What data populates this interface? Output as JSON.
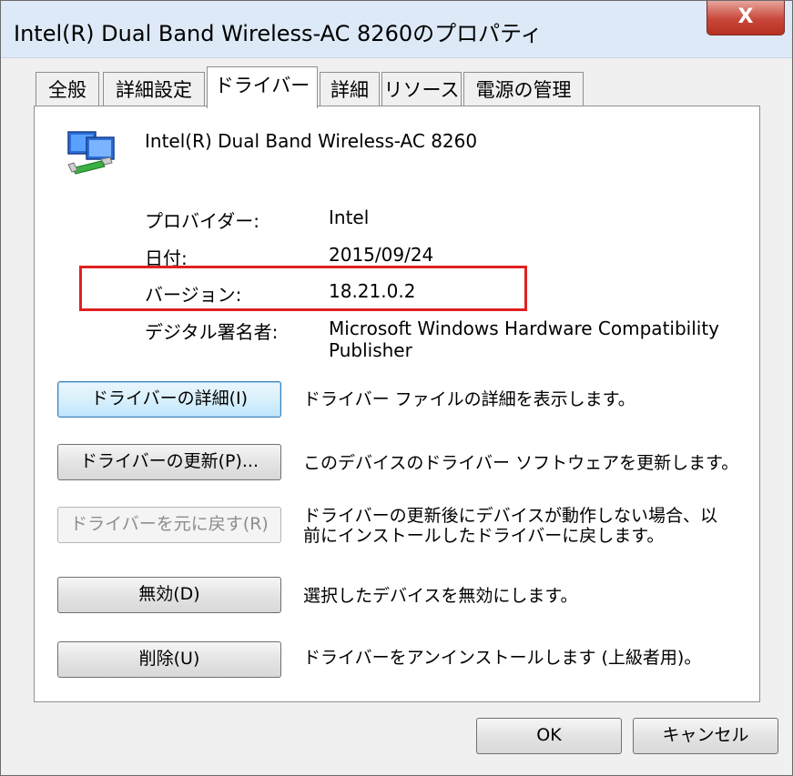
{
  "window": {
    "title": "Intel(R) Dual Band Wireless-AC 8260のプロパティ",
    "close_label": "X"
  },
  "tabs": [
    {
      "label": "全般"
    },
    {
      "label": "詳細設定"
    },
    {
      "label": "ドライバー",
      "active": true
    },
    {
      "label": "詳細"
    },
    {
      "label": "リソース"
    },
    {
      "label": "電源の管理"
    }
  ],
  "device": {
    "icon": "network-adapter-icon",
    "name": "Intel(R) Dual Band Wireless-AC 8260"
  },
  "properties": {
    "provider_label": "プロバイダー:",
    "provider_value": "Intel",
    "date_label": "日付:",
    "date_value": "2015/09/24",
    "version_label": "バージョン:",
    "version_value": "18.21.0.2",
    "signer_label": "デジタル署名者:",
    "signer_value_line1": "Microsoft Windows Hardware Compatibility",
    "signer_value_line2": "Publisher"
  },
  "actions": {
    "details_button": "ドライバーの詳細(I)",
    "details_desc": "ドライバー ファイルの詳細を表示します。",
    "update_button": "ドライバーの更新(P)...",
    "update_desc": "このデバイスのドライバー ソフトウェアを更新します。",
    "rollback_button": "ドライバーを元に戻す(R)",
    "rollback_desc_line1": "ドライバーの更新後にデバイスが動作しない場合、以",
    "rollback_desc_line2": "前にインストールしたドライバーに戻します。",
    "disable_button": "無効(D)",
    "disable_desc": "選択したデバイスを無効にします。",
    "uninstall_button": "削除(U)",
    "uninstall_desc": "ドライバーをアンインストールします (上級者用)。"
  },
  "footer": {
    "ok_label": "OK",
    "cancel_label": "キャンセル"
  },
  "colors": {
    "highlight_box": "#e02020",
    "close_button": "#c7473a"
  }
}
